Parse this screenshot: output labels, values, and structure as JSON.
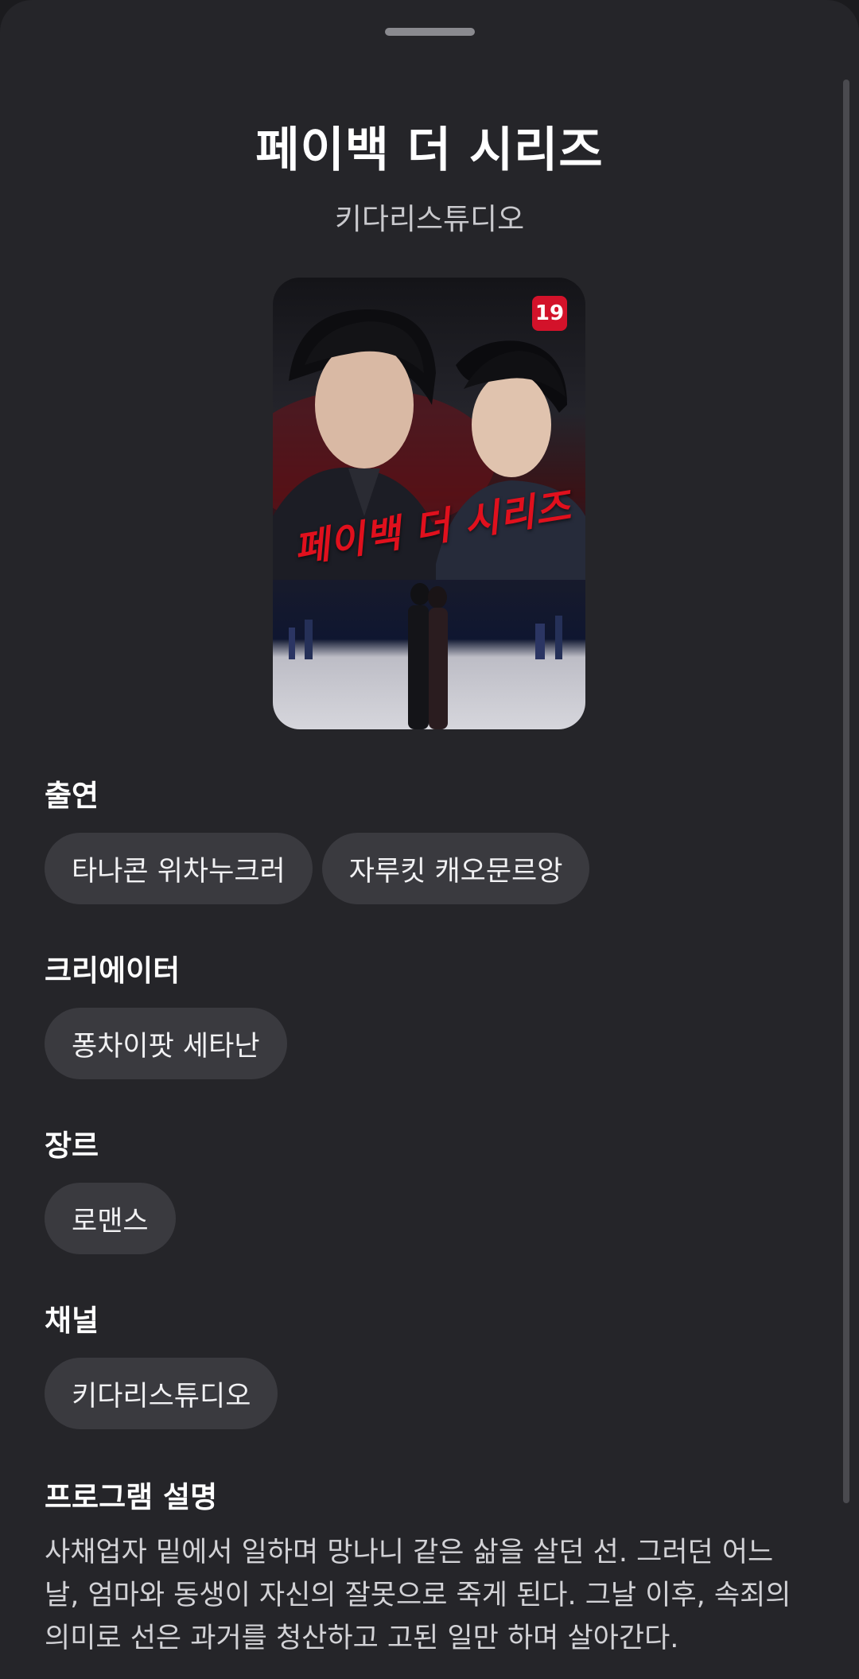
{
  "program": {
    "title": "페이백 더 시리즈",
    "channel_name": "키다리스튜디오",
    "poster": {
      "title_text": "페이백 더 시리즈",
      "age_rating": "19"
    }
  },
  "sections": {
    "cast": {
      "label": "출연",
      "chips": [
        "타나콘 위차누크러",
        "자루킷 캐오문르앙"
      ]
    },
    "creator": {
      "label": "크리에이터",
      "chips": [
        "퐁차이팟 세타난"
      ]
    },
    "genre": {
      "label": "장르",
      "chips": [
        "로맨스"
      ]
    },
    "channel": {
      "label": "채널",
      "chips": [
        "키다리스튜디오"
      ]
    },
    "description": {
      "label": "프로그램 설명",
      "text": "사채업자 밑에서 일하며 망나니 같은 삶을 살던 선. 그러던 어느 날, 엄마와 동생이 자신의 잘못으로 죽게 된다. 그날 이후, 속죄의 의미로 선은 과거를 청산하고 고된 일만 하며 살아간다."
    }
  },
  "colors": {
    "background": "#252529",
    "chip": "#3a3a3f",
    "age_badge": "#d3122a",
    "poster_title": "#e0101d"
  }
}
